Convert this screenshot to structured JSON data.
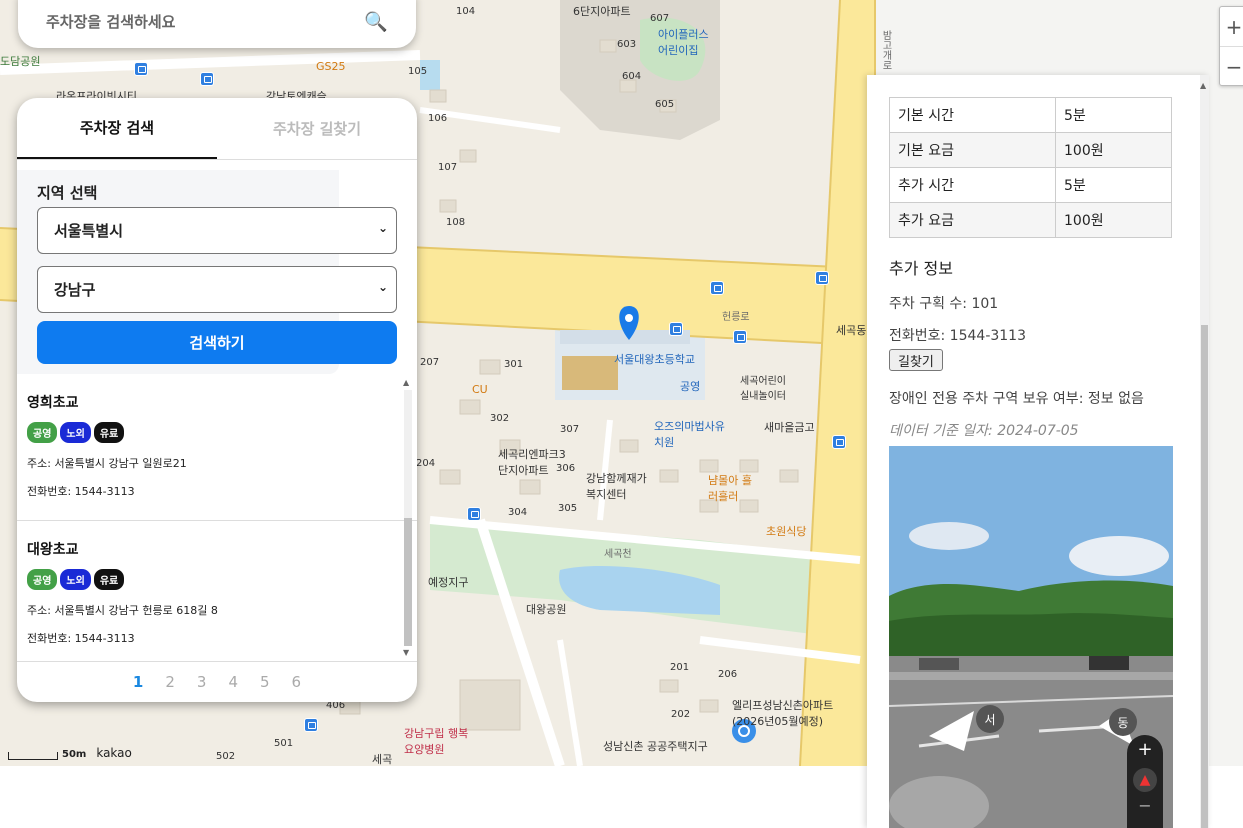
{
  "search": {
    "placeholder": "주차장을 검색하세요"
  },
  "tabs": [
    "주차장 검색",
    "주차장 길찾기"
  ],
  "region": {
    "title": "지역 선택",
    "city": "서울특별시",
    "district": "강남구",
    "search_button": "검색하기"
  },
  "results": [
    {
      "name": "영희초교",
      "badges": [
        "공영",
        "노외",
        "유료"
      ],
      "address": "주소: 서울특별시 강남구 일원로21",
      "phone": "전화번호: 1544-3113"
    },
    {
      "name": "대왕초교",
      "badges": [
        "공영",
        "노외",
        "유료"
      ],
      "address": "주소: 서울특별시 강남구 헌릉로 618길 8",
      "phone": "전화번호: 1544-3113"
    }
  ],
  "pagination": {
    "current": "1",
    "pages": [
      "1",
      "2",
      "3",
      "4",
      "5",
      "6"
    ]
  },
  "detail": {
    "table": [
      {
        "label": "기본 시간",
        "value": "5분"
      },
      {
        "label": "기본 요금",
        "value": "100원"
      },
      {
        "label": "추가 시간",
        "value": "5분"
      },
      {
        "label": "추가 요금",
        "value": "100원"
      }
    ],
    "extra_title": "추가 정보",
    "spaces": "주차 구획 수: 101",
    "phone": "전화번호: 1544-3113",
    "route_button": "길찾기",
    "disabled_parking": "장애인 전용 주차 구역 보유 여부: 정보 없음",
    "data_date": "데이터 기준 일자: 2024-07-05",
    "roadview_west": "서",
    "roadview_east": "동"
  },
  "map": {
    "labels": {
      "school": "서울대왕초등학교",
      "public": "공영",
      "ozs": "오즈의마법사유치원",
      "saemaeul": "새마을금고",
      "apt_seg": "세곡리엔파크3단지아파트",
      "welfare": "강남함께재가복지센터",
      "nyum": "냠몰아 흘러흘러",
      "chowon": "초원식당",
      "daewang_park": "대왕공원",
      "hospital": "강남구립 행복요양병원",
      "elip": "엘리프성남신촌아파트 (2026년05월예정)",
      "public_house": "성남신촌 공공주택지구",
      "kids": "아이플러스 어린이집",
      "kids2": "세곡어린이 실내놀이터",
      "hunreung": "헌릉로",
      "segok": "세곡동",
      "segokcheon": "세곡천",
      "bamgo": "밤고개로",
      "cu": "CU",
      "gs25": "GS25",
      "dodam": "도담공원",
      "laon": "라온프라이빗시티",
      "gangnam_ent": "강남토엔캐슬",
      "apt6": "6단지아파트",
      "scheduled": "예정지구",
      "segok_bottom": "세곡"
    },
    "numbers": [
      "104",
      "105",
      "106",
      "107",
      "108",
      "207",
      "301",
      "302",
      "307",
      "304",
      "305",
      "306",
      "204",
      "603",
      "604",
      "605",
      "607",
      "201",
      "202",
      "206",
      "406",
      "501",
      "502"
    ],
    "scale": "50m",
    "brand": "kakao"
  }
}
